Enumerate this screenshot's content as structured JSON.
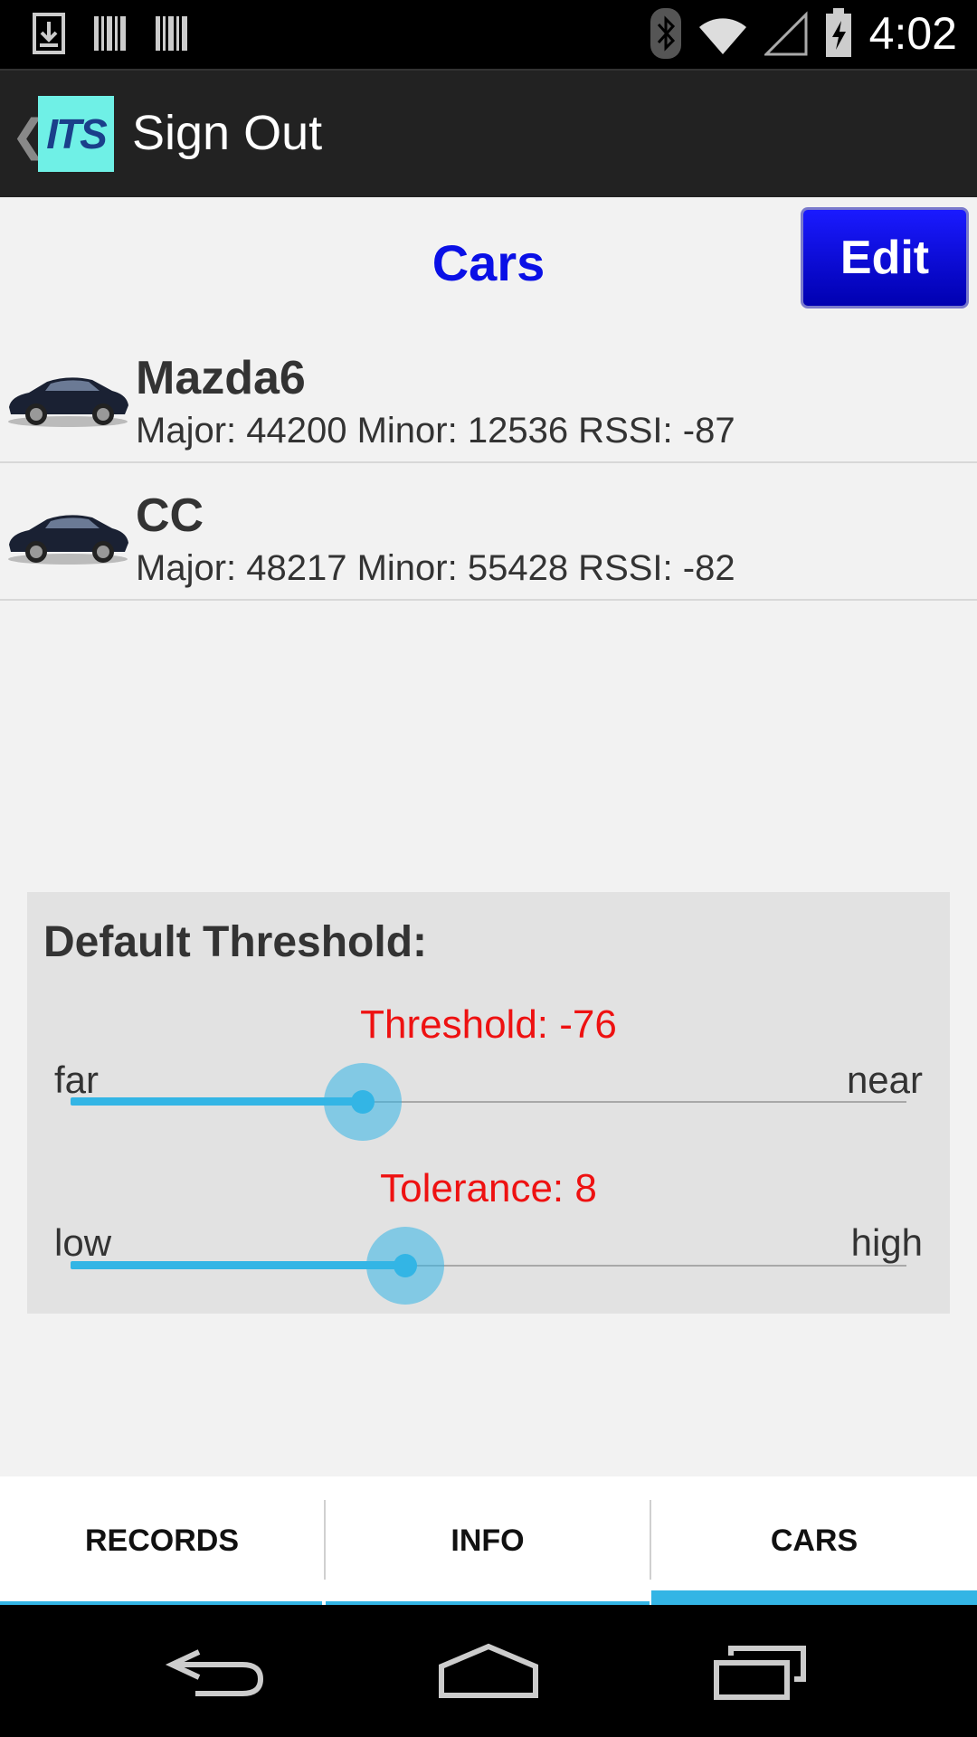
{
  "status_bar": {
    "time": "4:02",
    "left_icons": [
      "download-icon",
      "barcode-icon",
      "barcode-icon"
    ],
    "right_icons": [
      "bluetooth-icon",
      "wifi-icon",
      "signal-icon",
      "battery-icon"
    ]
  },
  "action_bar": {
    "logo_text": "ITS",
    "title": "Sign Out",
    "up_icon": "back-caret-icon"
  },
  "header": {
    "title": "Cars",
    "edit_label": "Edit"
  },
  "cars": [
    {
      "name": "Mazda6",
      "details": "Major: 44200 Minor: 12536 RSSI: -87",
      "icon": "car-icon"
    },
    {
      "name": "CC",
      "details": "Major: 48217 Minor: 55428 RSSI: -82",
      "icon": "car-icon"
    }
  ],
  "threshold_panel": {
    "title": "Default Threshold:",
    "threshold": {
      "label": "Threshold: -76",
      "min_label": "far",
      "max_label": "near",
      "level_fraction": 0.35
    },
    "tolerance": {
      "label": "Tolerance: 8",
      "min_label": "low",
      "max_label": "high",
      "level_fraction": 0.4
    }
  },
  "tabs": [
    {
      "label": "RECORDS",
      "active": false
    },
    {
      "label": "INFO",
      "active": false
    },
    {
      "label": "CARS",
      "active": true
    }
  ],
  "nav_bar": {
    "icons": [
      "back-icon",
      "home-icon",
      "recents-icon"
    ]
  },
  "colors": {
    "accent": "#33b5e5",
    "title_blue": "#0a10e6",
    "value_red": "#ee1111",
    "action_bar": "#222222"
  }
}
